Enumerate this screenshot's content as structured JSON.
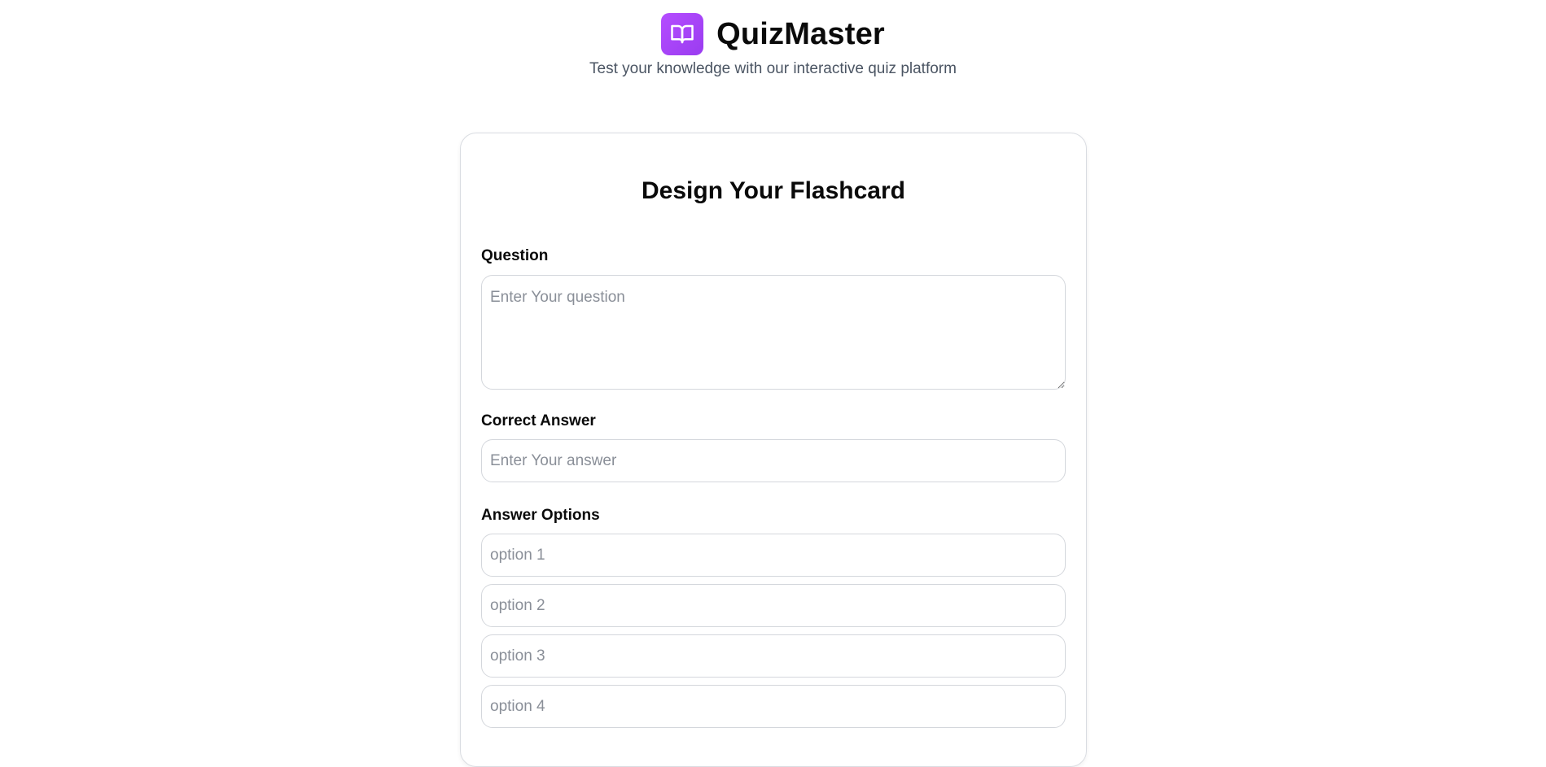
{
  "header": {
    "logo_icon": "open-book-icon",
    "brand_color": "#a845f7",
    "title": "QuizMaster",
    "tagline": "Test your knowledge with our interactive quiz platform"
  },
  "card": {
    "title": "Design Your Flashcard",
    "question": {
      "label": "Question",
      "placeholder": "Enter Your question",
      "value": ""
    },
    "answer": {
      "label": "Correct Answer",
      "placeholder": "Enter Your answer",
      "value": ""
    },
    "options": {
      "label": "Answer Options",
      "items": [
        {
          "placeholder": "option 1",
          "value": ""
        },
        {
          "placeholder": "option 2",
          "value": ""
        },
        {
          "placeholder": "option 3",
          "value": ""
        },
        {
          "placeholder": "option 4",
          "value": ""
        }
      ]
    }
  }
}
